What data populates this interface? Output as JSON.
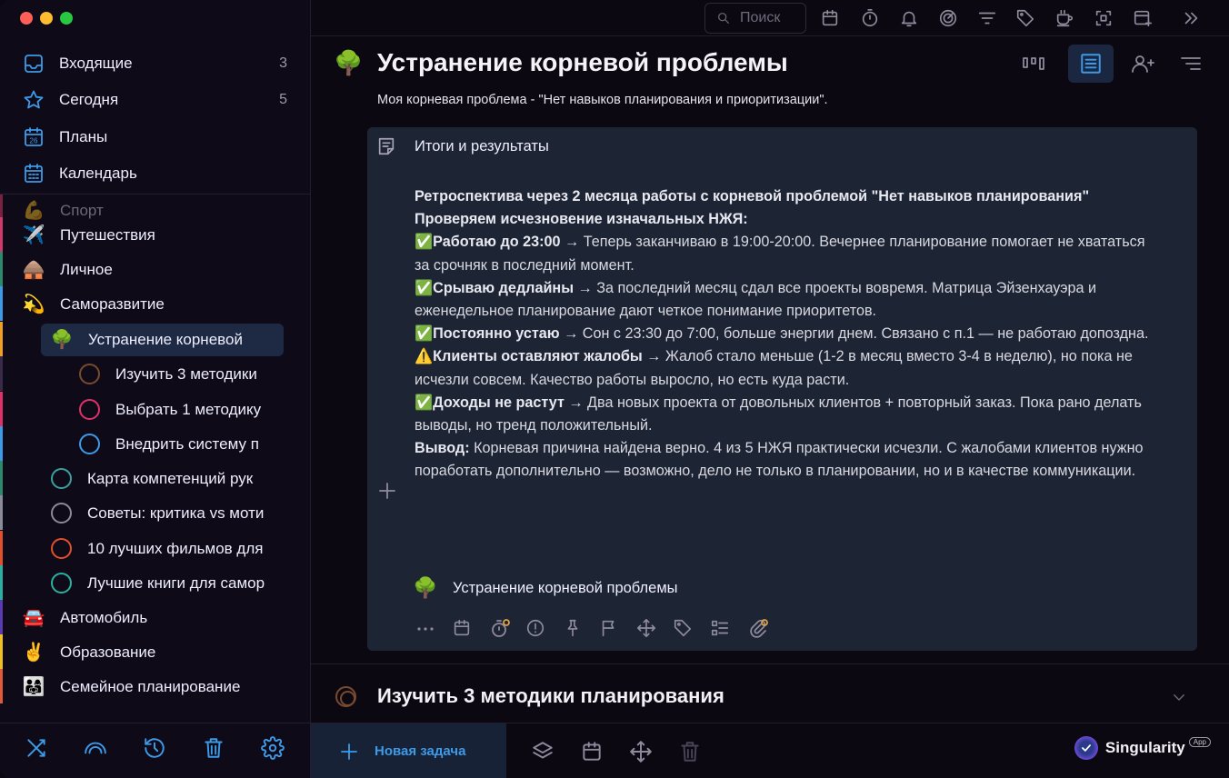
{
  "window": {
    "controls": [
      "close",
      "minimize",
      "maximize"
    ]
  },
  "sidebar": {
    "nav": [
      {
        "label": "Входящие",
        "count": "3",
        "icon": "inbox-icon"
      },
      {
        "label": "Сегодня",
        "count": "5",
        "icon": "star-icon"
      },
      {
        "label": "Планы",
        "count": "",
        "icon": "plans-calendar-icon",
        "icon_text": "26"
      },
      {
        "label": "Календарь",
        "count": "",
        "icon": "calendar-grid-icon"
      }
    ],
    "tree": [
      {
        "label": "Спорт",
        "emoji": "💪",
        "bar": "#7a2040",
        "faded": true
      },
      {
        "label": "Путешествия",
        "emoji": "✈️",
        "bar": "#d03a6a"
      },
      {
        "label": "Личное",
        "emoji": "🛖",
        "bar": "#2a8a6a"
      },
      {
        "label": "Саморазвитие",
        "emoji": "💫",
        "bar": "#3d9ae8"
      },
      {
        "label": "Устранение корневой",
        "emoji": "🌳",
        "bar": "#f0a020",
        "selected": true
      },
      {
        "label": "Изучить 3 методики",
        "circle": "#7a4a2e",
        "bar": "#3a2a4a"
      },
      {
        "label": "Выбрать 1 методику",
        "circle": "#e0306a",
        "bar": "#e0306a"
      },
      {
        "label": "Внедрить систему п",
        "circle": "#3d9ae8",
        "bar": "#3d9ae8"
      },
      {
        "label": "Карта компетенций рук",
        "circle": "#3aa0a0",
        "bar": "#2a8a6a"
      },
      {
        "label": "Советы: критика vs моти",
        "circle": "#8a8a9a",
        "bar": "#8a8a9a"
      },
      {
        "label": "10 лучших фильмов для",
        "circle": "#e0502a",
        "bar": "#e0502a"
      },
      {
        "label": "Лучшие книги для самор",
        "circle": "#2ab0a0",
        "bar": "#2ab0a0"
      },
      {
        "label": "Автомобиль",
        "emoji": "🚘",
        "bar": "#5a3ab0"
      },
      {
        "label": "Образование",
        "emoji": "✌️",
        "bar": "#f0c020"
      },
      {
        "label": "Семейное планирование",
        "emoji": "👨‍👩‍👧",
        "bar": "#e05a3a"
      }
    ],
    "bottom": [
      "shuffle-icon",
      "rainbow-icon",
      "history-icon",
      "trash-icon",
      "settings-gear-icon"
    ]
  },
  "toolbar": {
    "search_placeholder": "Поиск",
    "icons": [
      "calendar-icon",
      "timer-icon",
      "bell-icon",
      "focus-target-icon",
      "filter-icon",
      "tag-icon",
      "cup-icon",
      "scan-icon",
      "add-window-icon",
      "collapse-right-icon"
    ]
  },
  "main": {
    "emoji": "🌳",
    "title": "Устранение корневой проблемы",
    "subtitle": "Моя корневая проблема - \"Нет навыков планирования и приоритизации\".",
    "header_buttons": [
      "kanban-view-icon",
      "list-view-icon",
      "add-user-icon",
      "sort-menu-icon"
    ],
    "note": {
      "title": "Итоги и результаты",
      "heading1": "Ретроспектива через 2 месяца работы с корневой проблемой \"Нет навыков планирования\"",
      "heading2": "Проверяем исчезновение изначальных НЖЯ:",
      "items": [
        {
          "mark": "✅",
          "bold": "Работаю до 23:00",
          "text": " → Теперь заканчиваю в 19:00-20:00. Вечернее планирование помогает не хвататься за срочняк в последний момент."
        },
        {
          "mark": "✅",
          "bold": "Срываю дедлайны",
          "text": " → За последний месяц сдал все проекты вовремя. Матрица Эйзенхауэра и еженедельное планирование дают четкое понимание приоритетов."
        },
        {
          "mark": "✅",
          "bold": "Постоянно устаю",
          "text": " → Сон с 23:30 до 7:00, больше энергии днем. Связано с п.1 — не работаю допоздна."
        },
        {
          "mark": "⚠️",
          "bold": "Клиенты оставляют жалобы",
          "text": " → Жалоб стало меньше (1-2 в месяц вместо 3-4 в неделю), но пока не исчезли совсем. Качество работы выросло, но есть куда расти."
        },
        {
          "mark": "✅",
          "bold": "Доходы не растут",
          "text": " → Два новых проекта от довольных клиентов + повторный заказ. Пока рано делать выводы, но тренд положительный."
        }
      ],
      "conclusion_bold": "Вывод:",
      "conclusion_text": " Корневая причина найдена верно. 4 из 5 НЖЯ практически исчезли. С жалобами клиентов нужно поработать дополнительно — возможно, дело не только в планировании, но и в качестве коммуникации.",
      "link_emoji": "🌳",
      "link_label": "Устранение корневой проблемы",
      "actions": [
        "more-icon",
        "calendar-icon",
        "timer-icon",
        "priority-icon",
        "pin-icon",
        "flag-icon",
        "move-icon",
        "tag-icon",
        "checklist-icon",
        "attach-icon"
      ]
    },
    "task": {
      "title": "Изучить 3 методики планирования"
    }
  },
  "footer": {
    "new_task": "Новая задача",
    "icons": [
      "layers-icon",
      "calendar-icon",
      "move-icon",
      "trash-icon"
    ],
    "brand": "Singularity",
    "brand_badge": "App"
  }
}
